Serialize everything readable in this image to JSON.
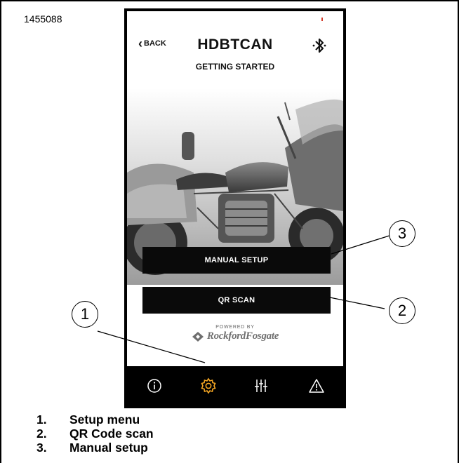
{
  "figure_id": "1455088",
  "app": {
    "back_label": "BACK",
    "title": "HDBTCAN",
    "subtitle": "GETTING STARTED",
    "manual_setup_label": "MANUAL SETUP",
    "qr_scan_label": "QR SCAN",
    "powered_by": "POWERED BY",
    "brand": "Rockford Fosgate"
  },
  "icons": {
    "header_right": "bluetooth-icon",
    "tabs": [
      "info-icon",
      "gear-icon",
      "sliders-icon",
      "warning-icon"
    ],
    "active_tab_color": "#f5a623"
  },
  "callouts": [
    "1",
    "2",
    "3"
  ],
  "legend": [
    {
      "num": "1.",
      "text": "Setup menu"
    },
    {
      "num": "2.",
      "text": "QR Code scan"
    },
    {
      "num": "3.",
      "text": "Manual setup"
    }
  ]
}
